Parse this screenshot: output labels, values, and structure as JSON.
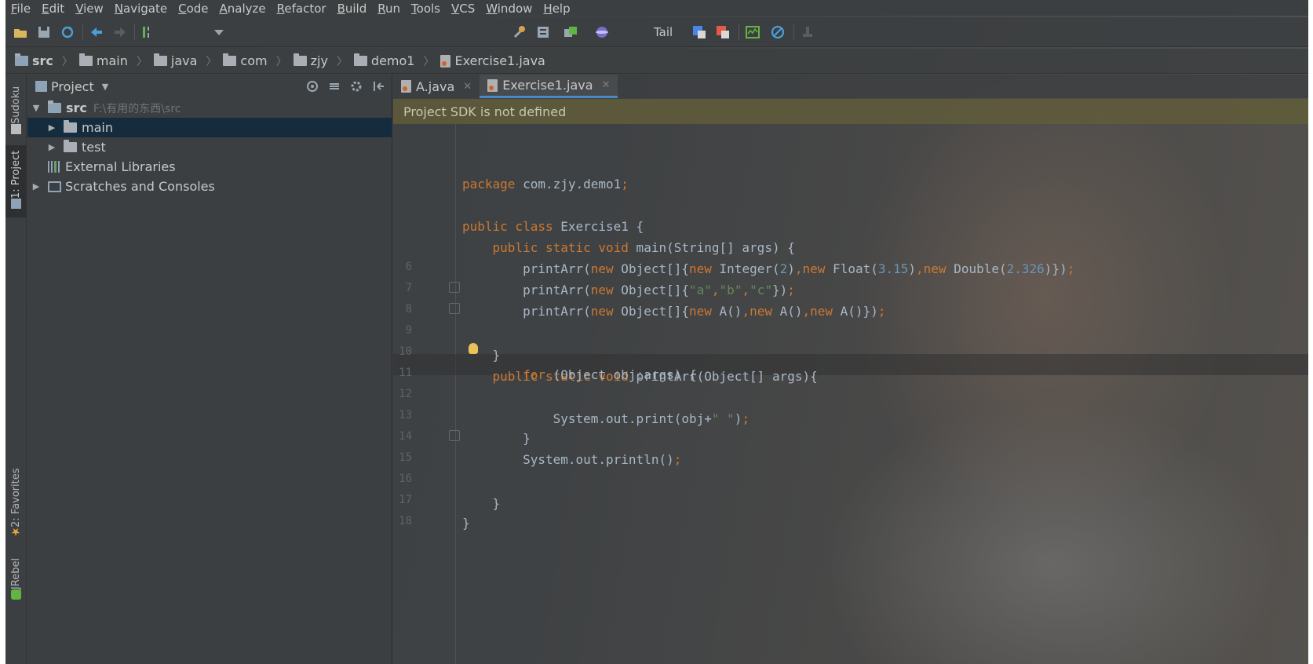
{
  "menu": [
    "File",
    "Edit",
    "View",
    "Navigate",
    "Code",
    "Analyze",
    "Refactor",
    "Build",
    "Run",
    "Tools",
    "VCS",
    "Window",
    "Help"
  ],
  "toolbar": {
    "tail_label": "Tail",
    "icons": [
      "open-folder-icon",
      "save-icon",
      "sync-icon",
      "back-arrow-icon",
      "forward-arrow-icon",
      "build-icon",
      "dropdown-icon",
      "wrench-icon",
      "structure-icon",
      "deploy-icon",
      "sphere-icon",
      "translate-icon",
      "translate-alt-icon",
      "monitor-icon",
      "block-icon",
      "stamp-icon"
    ]
  },
  "breadcrumb": [
    "src",
    "main",
    "java",
    "com",
    "zjy",
    "demo1",
    "Exercise1.java"
  ],
  "toolstrip": {
    "sudoku": "Sudoku",
    "project": "1: Project",
    "favorites": "2: Favorites",
    "jrebel": "JRebel"
  },
  "project_panel": {
    "title": "Project",
    "tree": [
      {
        "label": "src",
        "path": "F:\\有用的东西\\src"
      },
      {
        "label": "main"
      },
      {
        "label": "test"
      },
      {
        "label": "External Libraries"
      },
      {
        "label": "Scratches and Consoles"
      }
    ]
  },
  "tabs": [
    {
      "label": "A.java"
    },
    {
      "label": "Exercise1.java"
    }
  ],
  "notification": "Project SDK is not defined",
  "line_numbers": [
    "",
    "",
    "",
    "",
    "",
    "6",
    "7",
    "8",
    "9",
    "10",
    "11",
    "12",
    "13",
    "14",
    "15",
    "16",
    "17",
    "18"
  ],
  "colors": {
    "keyword": "#cc7832",
    "string": "#6a8759",
    "number": "#6897bb",
    "plain": "#a9b7c6",
    "tab_underline": "#4a88c7"
  }
}
